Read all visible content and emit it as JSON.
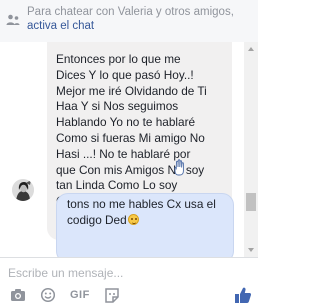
{
  "notice": {
    "text": "Para chatear con Valeria y otros amigos, ",
    "link": "activa el chat",
    "icon": "contacts-icon"
  },
  "messages": [
    {
      "direction": "incoming",
      "text": "Entonces por lo que me\nDices Y lo que pasó Hoy..!\nMejor me iré Olvidando de Ti\nHaa Y si Nos seguimos\nHablando Yo no te hablaré\nComo si fueras Mi amigo No\nHasi ...! No te hablaré  por\nque Con mis Amigos No soy\ntan Linda Como Lo soy\nContigo",
      "reaction_icon": "hand-icon"
    },
    {
      "direction": "outgoing",
      "text": "tons no me hables Cx usa el codigo Ded",
      "emoji": "smiley-emoji"
    }
  ],
  "composer": {
    "placeholder": "Escribe un mensaje...",
    "value": "",
    "gif_label": "GIF",
    "icons": [
      "camera-icon",
      "emoji-icon",
      "gif-icon",
      "sticker-icon",
      "like-icon"
    ]
  },
  "colors": {
    "accent": "#4267b2",
    "incoming_bubble": "#f1f0f0",
    "outgoing_bubble": "#dbe6fb"
  }
}
